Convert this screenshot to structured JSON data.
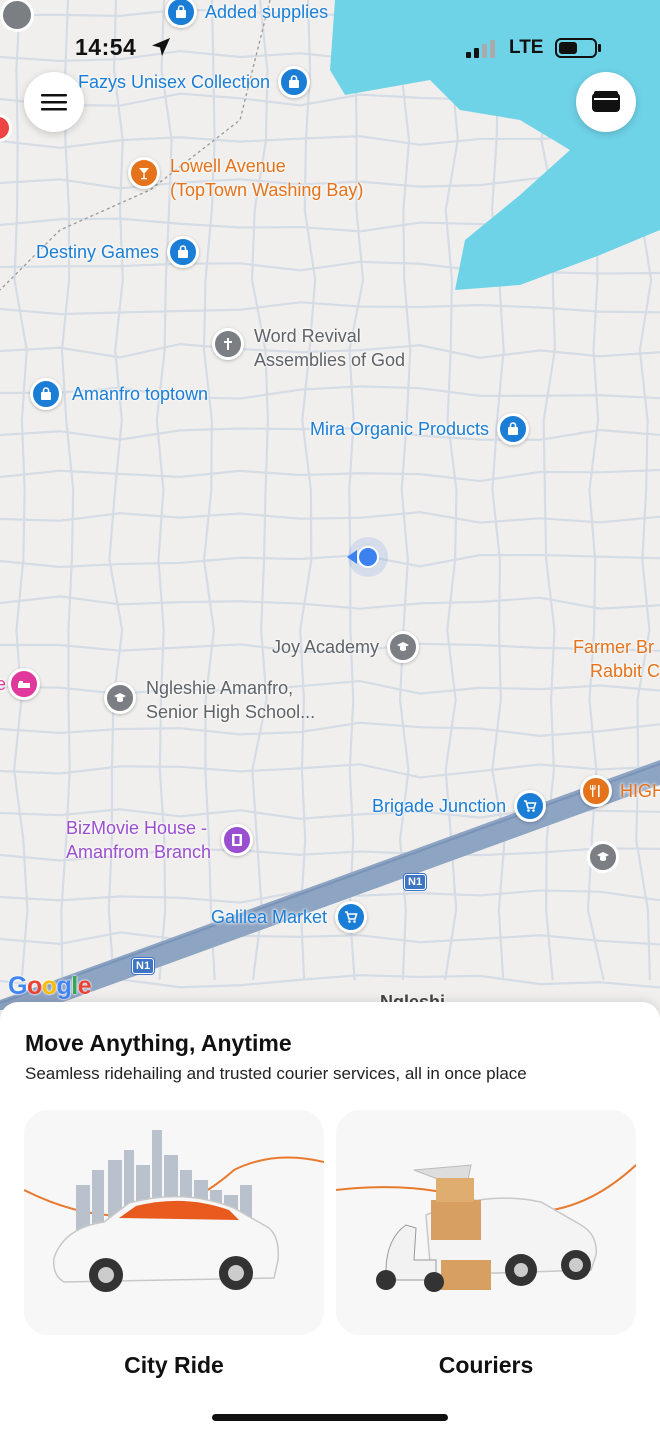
{
  "status_bar": {
    "time": "14:54",
    "network": "LTE"
  },
  "map": {
    "pois": [
      {
        "id": "added-supplies",
        "label": "Added supplies",
        "color": "blue",
        "icon": "shopping-bag-icon"
      },
      {
        "id": "fazys",
        "label": "Fazys Unisex Collection",
        "color": "blue",
        "icon": "shopping-bag-icon"
      },
      {
        "id": "lowell",
        "label_lines": [
          "Lowell Avenue",
          "(TopTown Washing Bay)"
        ],
        "color": "orange",
        "icon": "cocktail-icon"
      },
      {
        "id": "destiny",
        "label": "Destiny Games",
        "color": "blue",
        "icon": "shopping-bag-icon"
      },
      {
        "id": "word-revival",
        "label_lines": [
          "Word Revival",
          "Assemblies of God"
        ],
        "color": "gray",
        "icon": "cross-icon"
      },
      {
        "id": "amanfro-toptown",
        "label": "Amanfro toptown",
        "color": "blue",
        "icon": "shopping-bag-icon"
      },
      {
        "id": "mira",
        "label": "Mira Organic Products",
        "color": "blue",
        "icon": "shopping-bag-icon"
      },
      {
        "id": "joy-academy",
        "label": "Joy Academy",
        "color": "gray",
        "icon": "school-icon"
      },
      {
        "id": "farmer",
        "label_lines": [
          "Farmer Br",
          "Rabbit C"
        ],
        "color": "orange"
      },
      {
        "id": "ngleshie",
        "label_lines": [
          "Ngleshie Amanfro,",
          "Senior High School..."
        ],
        "color": "gray",
        "icon": "school-icon"
      },
      {
        "id": "brigade",
        "label": "Brigade Junction",
        "color": "blue",
        "icon": "cart-icon"
      },
      {
        "id": "high",
        "label": "HIGH",
        "color": "orange",
        "icon": "restaurant-icon"
      },
      {
        "id": "bizmovie",
        "label_lines": [
          "BizMovie House -",
          "Amanfrom Branch"
        ],
        "color": "purple",
        "icon": "film-icon"
      },
      {
        "id": "galilea",
        "label": "Galilea Market",
        "color": "blue",
        "icon": "cart-icon"
      },
      {
        "id": "nglesh-partial",
        "label": "Ngleshi"
      }
    ],
    "road_badges": [
      "N1",
      "N1"
    ],
    "attribution": "Google"
  },
  "sheet": {
    "title": "Move Anything, Anytime",
    "subtitle": "Seamless ridehailing and trusted courier services, all in once place",
    "services": [
      {
        "label": "City Ride"
      },
      {
        "label": "Couriers"
      }
    ]
  },
  "colors": {
    "poi_blue": "#1b7ed6",
    "poi_orange": "#e5731b",
    "poi_gray": "#7b7f84",
    "poi_purple": "#9a4fd0",
    "water": "#6fd3e8",
    "accent": "#e8792d"
  }
}
